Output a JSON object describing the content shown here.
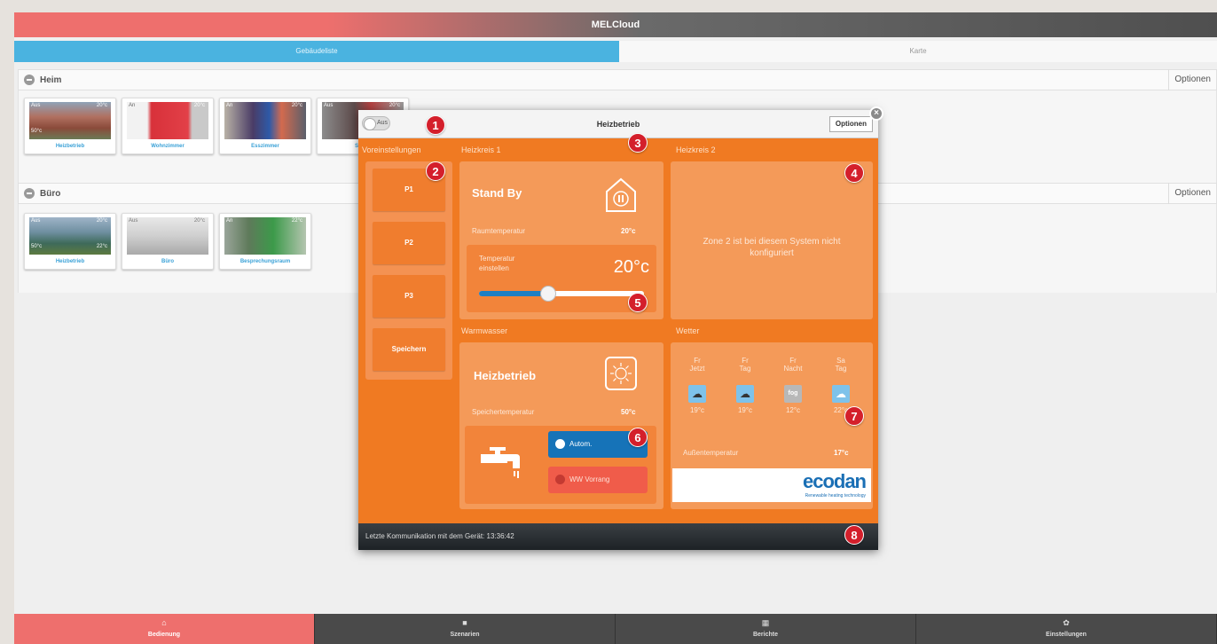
{
  "app": {
    "title": "MELCloud"
  },
  "tabs": [
    {
      "label": "Gebäudeliste"
    },
    {
      "label": "Karte"
    }
  ],
  "groups": [
    {
      "name": "Heim",
      "options": "Optionen",
      "devices": [
        {
          "status": "Aus",
          "temp": "20°c",
          "water": "50°c",
          "name": "Heizbetrieb"
        },
        {
          "status": "An",
          "temp": "20°c",
          "name": "Wohnzimmer"
        },
        {
          "status": "An",
          "temp": "20°c",
          "name": "Esszimmer"
        },
        {
          "status": "Aus",
          "temp": "20°c",
          "name": "Schlaf"
        }
      ]
    },
    {
      "name": "Büro",
      "options": "Optionen",
      "devices": [
        {
          "status": "Aus",
          "temp": "20°c",
          "water": "50°c",
          "water2": "22°c",
          "name": "Heizbetrieb"
        },
        {
          "status": "Aus",
          "temp": "20°c",
          "name": "Büro"
        },
        {
          "status": "An",
          "temp": "22°c",
          "name": "Besprechungsraum"
        }
      ]
    }
  ],
  "dialog": {
    "power": "Aus",
    "title": "Heizbetrieb",
    "options": "Optionen",
    "close": "×",
    "presets_label": "Voreinstellungen",
    "presets": [
      "P1",
      "P2",
      "P3",
      "Speichern"
    ],
    "zone1": {
      "label": "Heizkreis 1",
      "state": "Stand By",
      "room_label": "Raumtemperatur",
      "room_value": "20°c",
      "set_label": "Temperatur einstellen",
      "set_value": "20°c",
      "slider_fraction": 0.42
    },
    "zone2": {
      "label": "Heizkreis 2",
      "message": "Zone 2 ist bei diesem System nicht konfiguriert"
    },
    "water": {
      "label": "Warmwasser",
      "state": "Heizbetrieb",
      "tank_label": "Speichertemperatur",
      "tank_value": "50°c",
      "auto": "Autom.",
      "priority": "WW Vorrang"
    },
    "weather": {
      "label": "Wetter",
      "days": [
        {
          "day": "Fr",
          "time": "Jetzt",
          "icon": "rain-cloud-icon",
          "temp": "19°c"
        },
        {
          "day": "Fr",
          "time": "Tag",
          "icon": "rain-cloud-icon",
          "temp": "19°c"
        },
        {
          "day": "Fr",
          "time": "Nacht",
          "icon": "fog-icon",
          "temp": "12°c",
          "icon_text": "fog"
        },
        {
          "day": "Sa",
          "time": "Tag",
          "icon": "cloud-icon",
          "temp": "22°c"
        }
      ],
      "outside_label": "Außentemperatur",
      "outside_value": "17°c",
      "brand": "ecodan",
      "brand_sub": "Renewable heating technology"
    },
    "footer": "Letzte Kommunikation mit dem Gerät: 13:36:42"
  },
  "markers": [
    "1",
    "2",
    "3",
    "4",
    "5",
    "6",
    "7",
    "8"
  ],
  "nav": [
    {
      "label": "Bedienung",
      "icon": "home-icon"
    },
    {
      "label": "Szenarien",
      "icon": "video-icon"
    },
    {
      "label": "Berichte",
      "icon": "grid-icon"
    },
    {
      "label": "Einstellungen",
      "icon": "gear-icon"
    }
  ],
  "colors": {
    "accent": "#ee6f6d",
    "dialog": "#f07a22",
    "blue": "#4ab3e0",
    "marker": "#d41f2b"
  }
}
